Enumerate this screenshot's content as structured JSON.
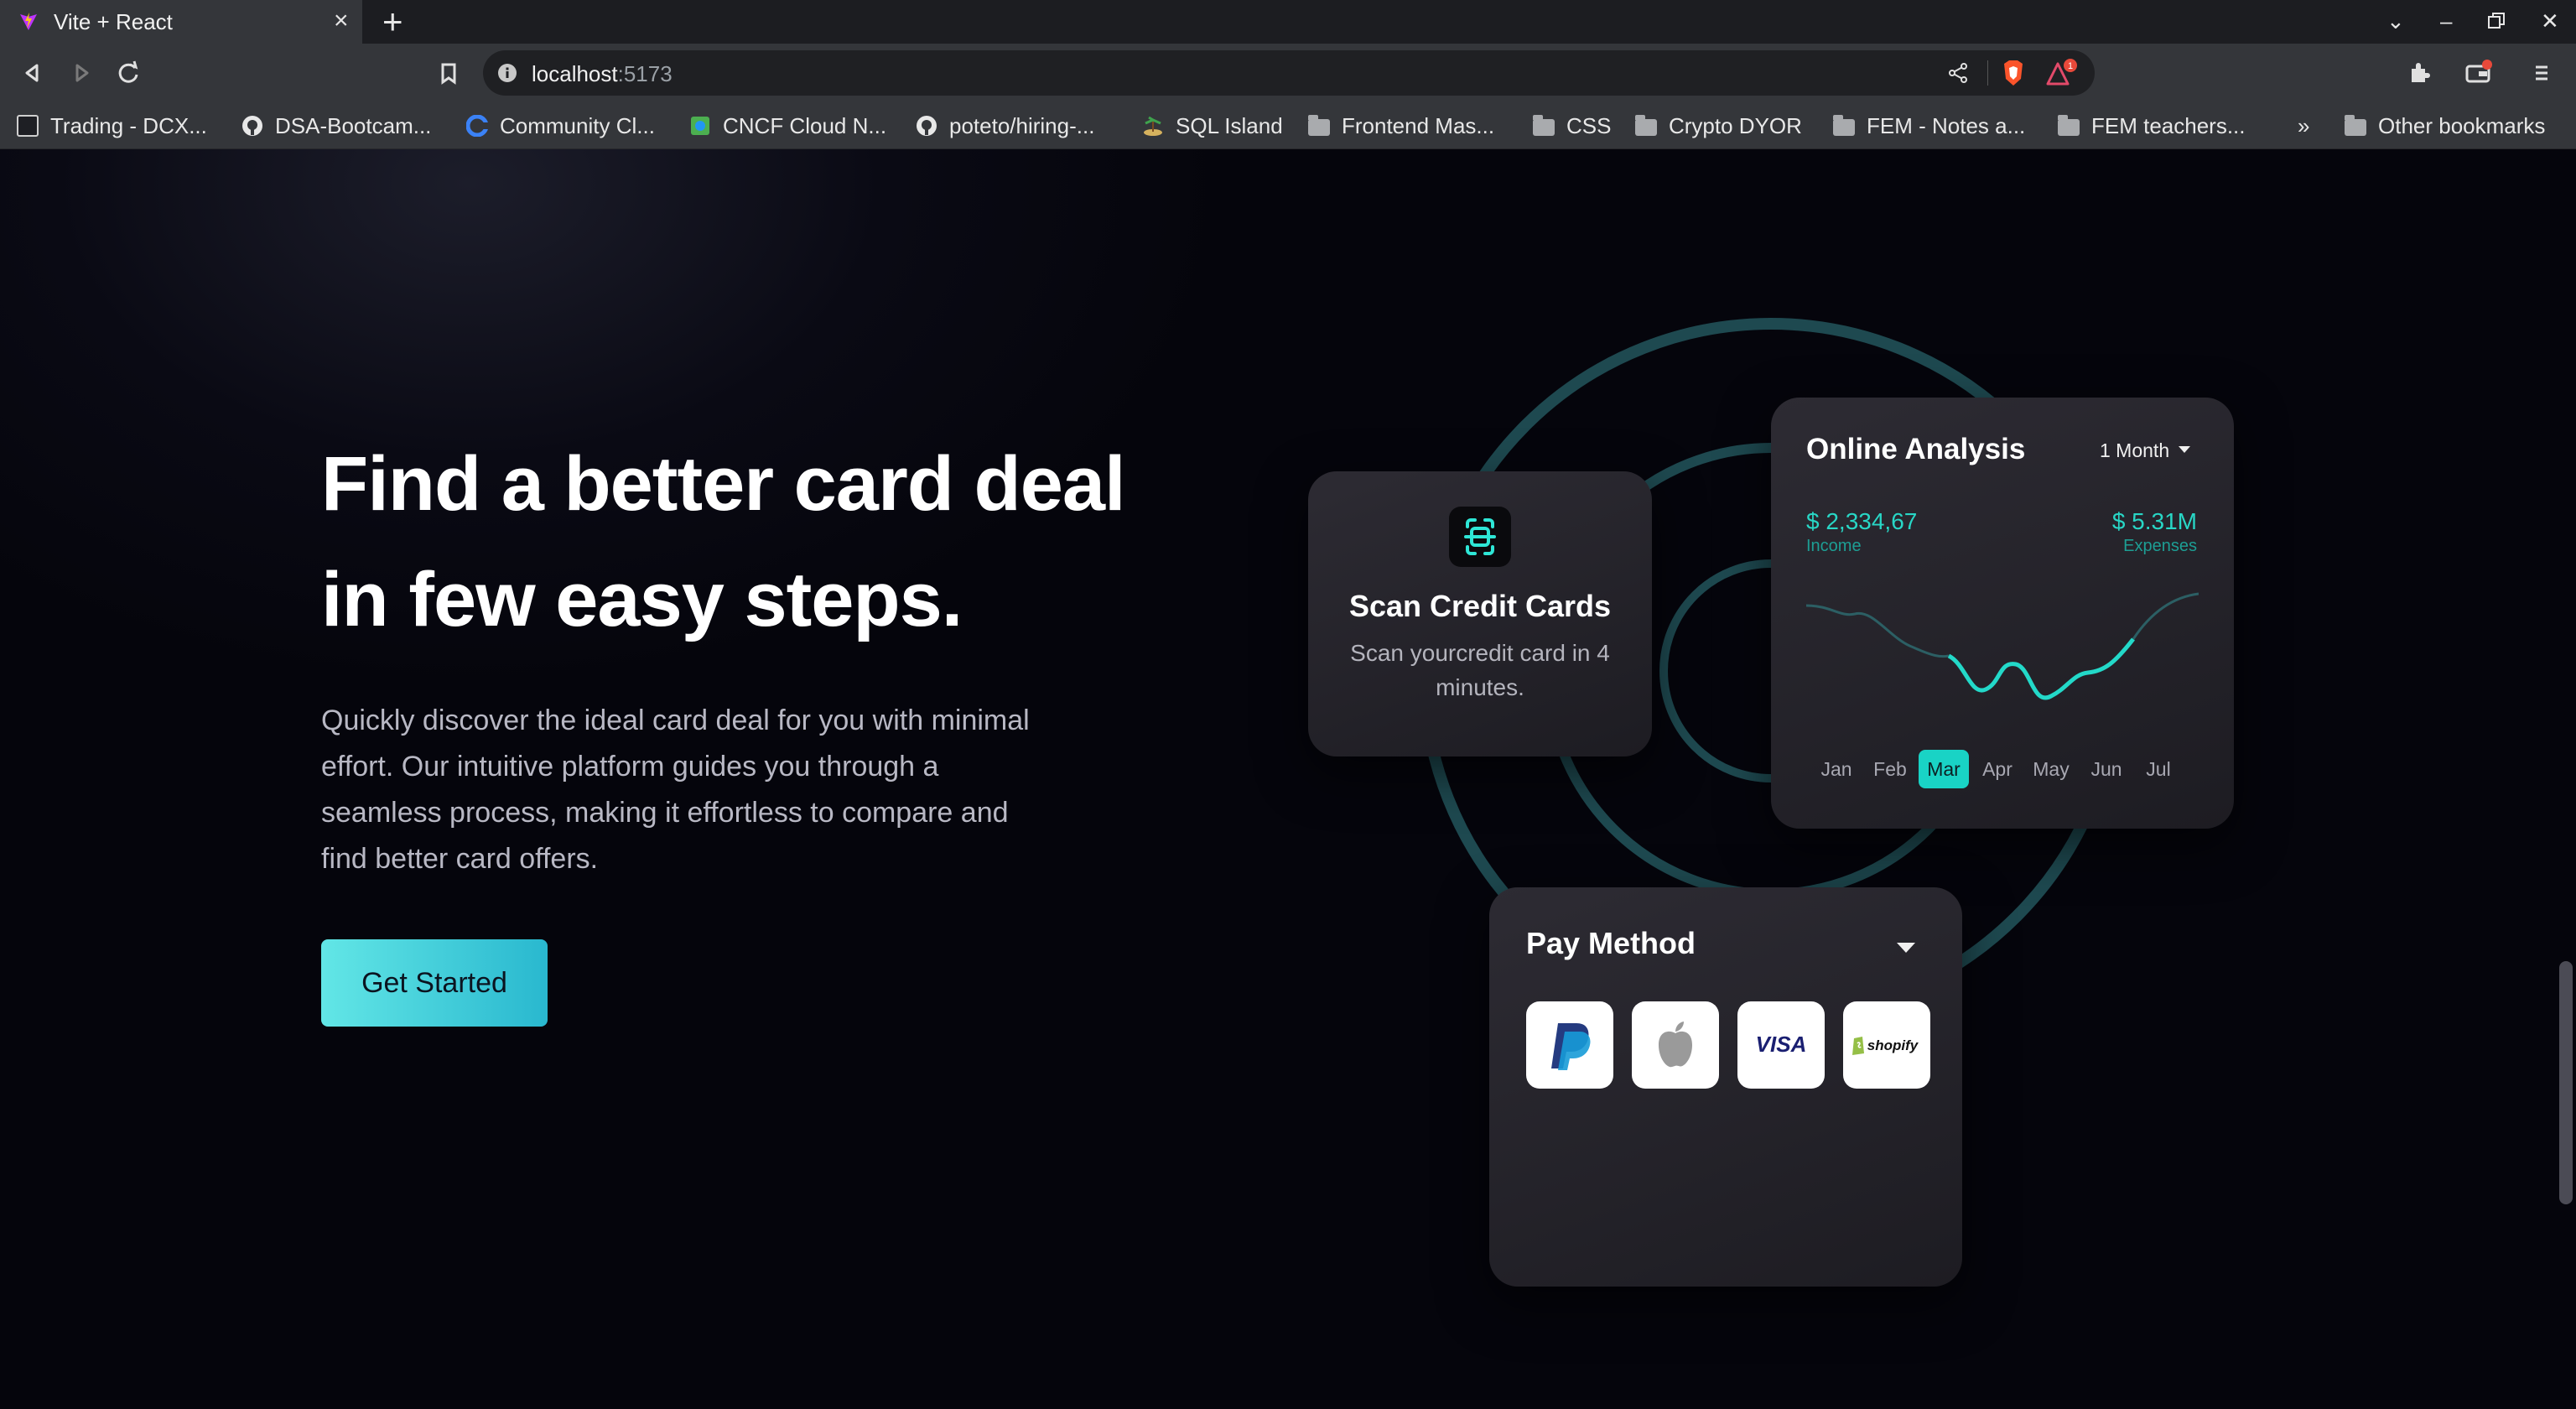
{
  "browser": {
    "tab_title": "Vite + React",
    "url_host": "localhost",
    "url_port": ":5173",
    "bookmarks": [
      {
        "label": "Trading - DCX...",
        "icon": "dcx-icon"
      },
      {
        "label": "DSA-Bootcam...",
        "icon": "github-icon"
      },
      {
        "label": "Community Cl...",
        "icon": "community-icon"
      },
      {
        "label": "CNCF Cloud N...",
        "icon": "cncf-icon"
      },
      {
        "label": "poteto/hiring-...",
        "icon": "github-icon"
      },
      {
        "label": "SQL Island",
        "icon": "island-icon"
      },
      {
        "label": "Frontend Mas...",
        "icon": "folder-icon"
      },
      {
        "label": "CSS",
        "icon": "folder-icon"
      },
      {
        "label": "Crypto DYOR",
        "icon": "folder-icon"
      },
      {
        "label": "FEM - Notes a...",
        "icon": "folder-icon"
      },
      {
        "label": "FEM teachers...",
        "icon": "folder-icon"
      },
      {
        "label": "Other bookmarks",
        "icon": "folder-icon"
      }
    ],
    "bookmarks_overflow": "»",
    "notification_count": "1"
  },
  "hero": {
    "title_line1": "Find a better card deal",
    "title_line2": "in few easy steps.",
    "description": "Quickly discover the ideal card deal for you with minimal effort. Our intuitive platform guides you through a seamless process, making it effortless to compare and find better card offers.",
    "cta_label": "Get Started"
  },
  "scan_card": {
    "title": "Scan Credit Cards",
    "subtitle": "Scan yourcredit card in 4 minutes."
  },
  "analysis_card": {
    "title": "Online Analysis",
    "period": "1 Month",
    "income_value": "$ 2,334,67",
    "income_label": "Income",
    "expenses_value": "$ 5.31M",
    "expenses_label": "Expenses",
    "months": [
      "Jan",
      "Feb",
      "Mar",
      "Apr",
      "May",
      "Jun",
      "Jul"
    ],
    "active_month": "Mar",
    "accent": "#19d3c5"
  },
  "pay_card": {
    "title": "Pay Method",
    "methods": [
      {
        "name": "PayPal",
        "icon": "paypal-icon"
      },
      {
        "name": "Apple",
        "icon": "apple-icon"
      },
      {
        "name": "VISA",
        "icon": "visa-icon"
      },
      {
        "name": "shopify",
        "icon": "shopify-icon"
      }
    ]
  }
}
